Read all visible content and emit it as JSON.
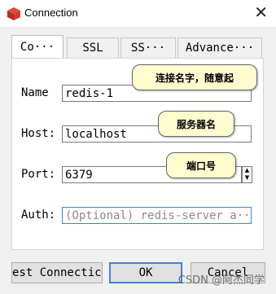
{
  "window": {
    "title": "Connection",
    "icon": "redis-cube-icon",
    "close_label": "✕"
  },
  "tabs": [
    {
      "label": "Co···",
      "active": true
    },
    {
      "label": "SSL"
    },
    {
      "label": "SS···"
    },
    {
      "label": "Advance···"
    }
  ],
  "form": {
    "name_label": "Name",
    "name_value": "redis-1",
    "host_label": "Host:",
    "host_value": "localhost",
    "port_label": "Port:",
    "port_value": "6379",
    "auth_label": "Auth:",
    "auth_placeholder": "(Optional) redis-server a···"
  },
  "annotations": {
    "name_tip": "连接名字，随意起",
    "host_tip": "服务器名",
    "port_tip": "端口号"
  },
  "buttons": {
    "test": "est Connectic",
    "ok": "OK",
    "cancel": "Cancel"
  },
  "watermark": "CSDN @阿杰同学"
}
